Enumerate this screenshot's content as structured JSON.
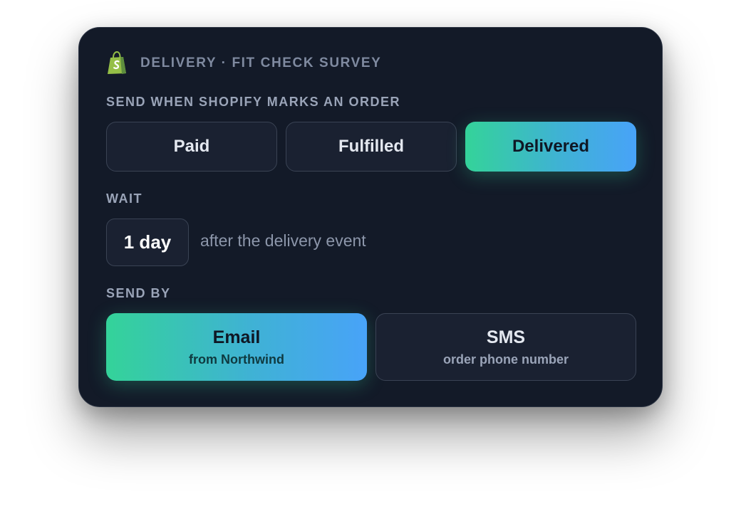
{
  "header": {
    "title": "DELIVERY · FIT CHECK SURVEY",
    "logo_icon": "shopify-bag-icon",
    "logo_color": "#95bf47"
  },
  "trigger": {
    "label": "SEND WHEN SHOPIFY MARKS AN ORDER",
    "options": [
      "Paid",
      "Fulfilled",
      "Delivered"
    ],
    "selected": "Delivered"
  },
  "wait": {
    "label": "WAIT",
    "value": "1 day",
    "suffix": "after the delivery event"
  },
  "send_by": {
    "label": "SEND BY",
    "options": [
      {
        "title": "Email",
        "subtitle": "from Northwind"
      },
      {
        "title": "SMS",
        "subtitle": "order phone number"
      }
    ],
    "selected": "Email"
  },
  "colors": {
    "card_bg": "#131a28",
    "accent_start": "#34d399",
    "accent_end": "#48a3f8"
  }
}
